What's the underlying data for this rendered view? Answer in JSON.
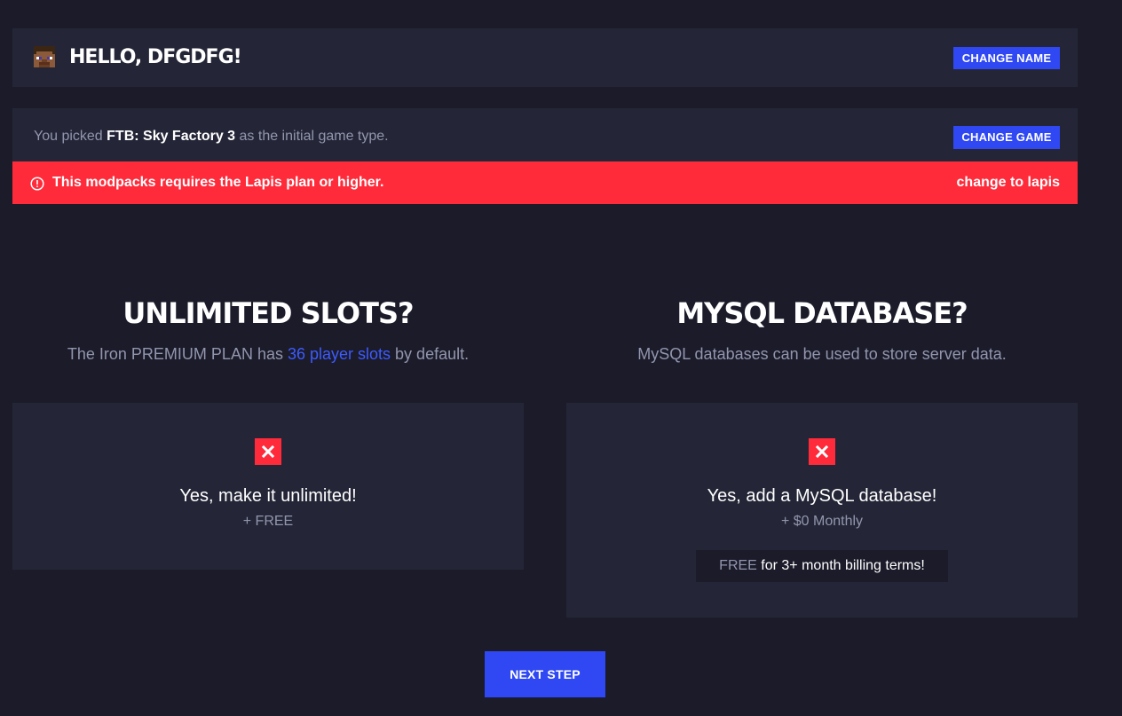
{
  "header": {
    "greeting": "HELLO, DFGDFG!",
    "change_name_label": "CHANGE NAME",
    "avatar_icon": "minecraft-steve-icon"
  },
  "game": {
    "prefix": "You picked ",
    "game_name": "FTB: Sky Factory 3",
    "suffix": " as the initial game type.",
    "change_game_label": "CHANGE GAME"
  },
  "alert": {
    "message": "This modpacks requires the Lapis plan or higher.",
    "action_label": "change to lapis",
    "color": "#ff2b3a",
    "icon": "alert-circle-icon"
  },
  "slots": {
    "title": "UNLIMITED SLOTS?",
    "desc_prefix": "The Iron PREMIUM PLAN has ",
    "desc_highlight": "36 player slots",
    "desc_suffix": " by default.",
    "option_label": "Yes, make it unlimited!",
    "option_price": "+ FREE",
    "checkbox_icon": "close-x-icon"
  },
  "mysql": {
    "title": "MYSQL DATABASE?",
    "description": "MySQL databases can be used to store server data.",
    "option_label": "Yes, add a MySQL database!",
    "option_price": "+ $0 Monthly",
    "promo_free": "FREE",
    "promo_rest": " for 3+ month billing terms!",
    "checkbox_icon": "close-x-icon"
  },
  "footer": {
    "next_label": "NEXT STEP"
  },
  "colors": {
    "accent": "#2f48f3",
    "danger": "#ff2b3a",
    "background": "#1b1b2a",
    "panel": "#242637",
    "link": "#3d5bff"
  }
}
